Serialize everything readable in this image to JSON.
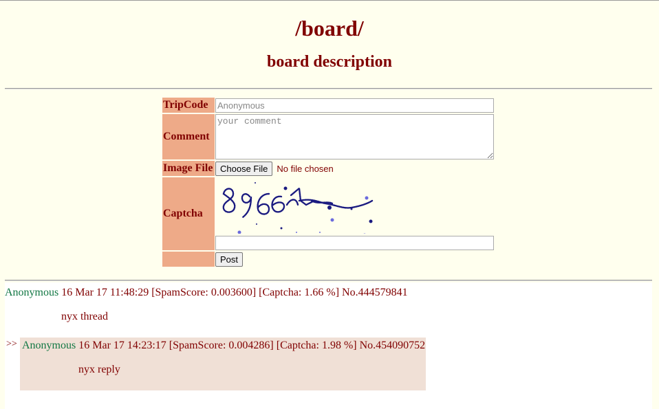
{
  "header": {
    "title": "/board/",
    "description": "board description"
  },
  "form": {
    "tripcode_label": "TripCode",
    "tripcode_placeholder": "Anonymous",
    "comment_label": "Comment",
    "comment_placeholder": "your comment",
    "image_label": "Image File",
    "choose_file_label": "Choose File",
    "file_status": "No file chosen",
    "captcha_label": "Captcha",
    "captcha_text": "89662",
    "post_button": "Post"
  },
  "thread": {
    "name": "Anonymous",
    "meta": "16 Mar 17 11:48:29 [SpamScore: 0.003600] [Captcha: 1.66 %] No.444579841",
    "body": "nyx thread"
  },
  "replies": [
    {
      "arrows": ">>",
      "name": "Anonymous",
      "meta": "16 Mar 17 14:23:17 [SpamScore: 0.004286] [Captcha: 1.98 %] No.454090752",
      "body": "nyx reply"
    }
  ],
  "colors": {
    "background": "#ffffee",
    "text": "#800000",
    "label_bg": "#eeaa88",
    "name": "#117743",
    "reply_bg": "#f0e0d6"
  }
}
